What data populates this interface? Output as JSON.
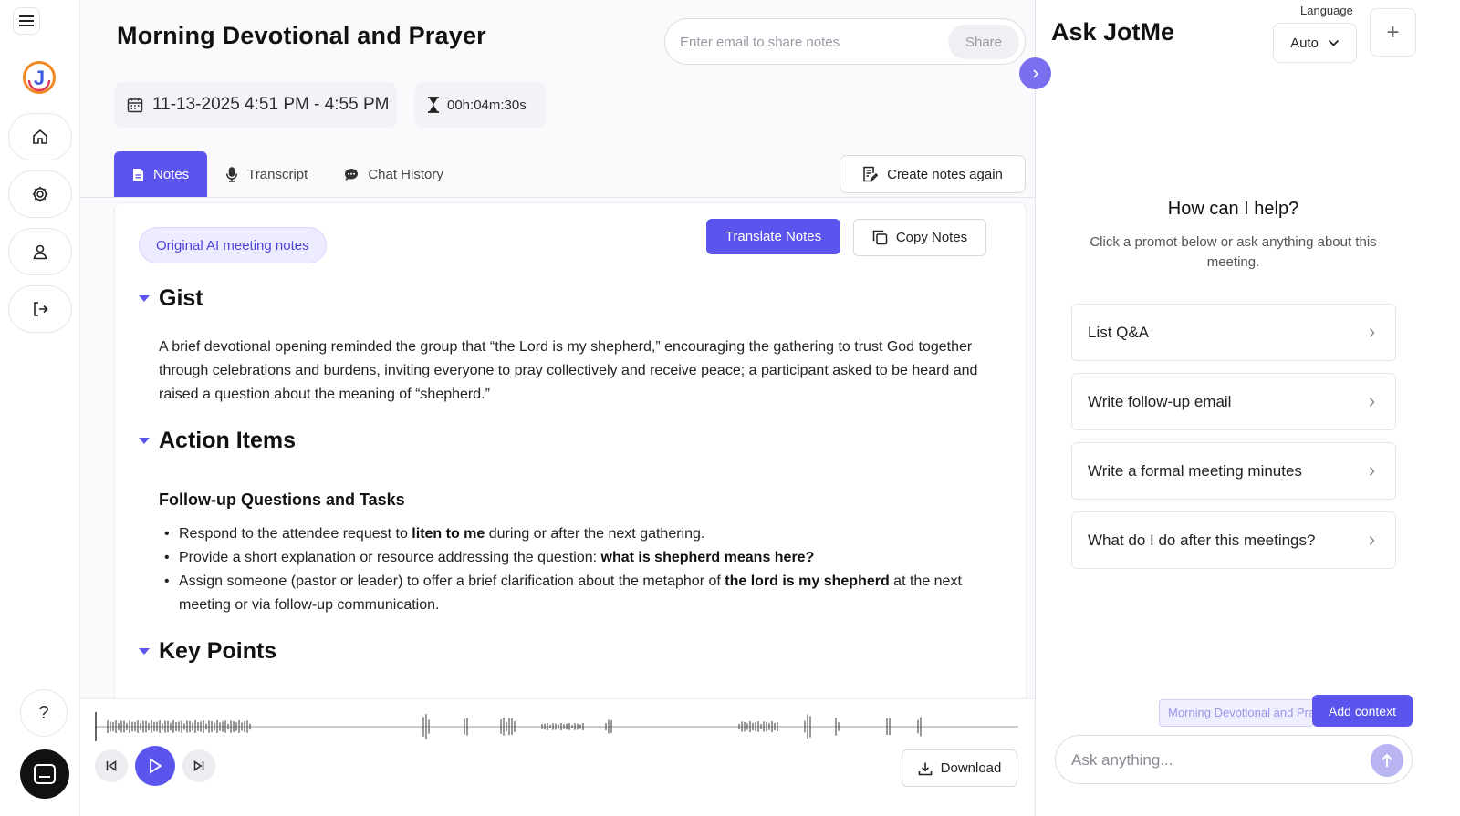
{
  "meeting": {
    "title": "Morning Devotional and Prayer",
    "date_range": "11-13-2025 4:51 PM - 4:55 PM",
    "duration": "00h:04m:30s"
  },
  "share": {
    "placeholder": "Enter email to share notes",
    "button": "Share"
  },
  "tabs": [
    {
      "label": "Notes",
      "icon": "document-icon",
      "active": true
    },
    {
      "label": "Transcript",
      "icon": "microphone-icon",
      "active": false
    },
    {
      "label": "Chat History",
      "icon": "chat-bubble-icon",
      "active": false
    }
  ],
  "toolbar": {
    "create_again": "Create notes again",
    "translate": "Translate Notes",
    "copy": "Copy Notes",
    "original_chip": "Original AI meeting notes"
  },
  "notes": {
    "gist_heading": "Gist",
    "gist_text": "A brief devotional opening reminded the group that “the Lord is my shepherd,” encouraging the gathering to trust God together through celebrations and burdens, inviting everyone to pray collectively and receive peace; a participant asked to be heard and raised a question about the meaning of “shepherd.”",
    "action_heading": "Action Items",
    "action_subheading": "Follow-up Questions and Tasks",
    "actions": [
      {
        "pre": "Respond to the attendee request to ",
        "bold": "liten to me",
        "post": " during or after the next gathering."
      },
      {
        "pre": "Provide a short explanation or resource addressing the question: ",
        "bold": "what is shepherd means here?",
        "post": ""
      },
      {
        "pre": "Assign someone (pastor or leader) to offer a brief clarification about the metaphor of ",
        "bold": "the lord is my shepherd",
        "post": " at the next meeting or via follow-up communication."
      }
    ],
    "keypoints_heading": "Key Points"
  },
  "player": {
    "download": "Download"
  },
  "ask": {
    "title": "Ask JotMe",
    "language_label": "Language",
    "language_value": "Auto",
    "new_button": "+",
    "help_title": "How can I help?",
    "help_sub": "Click a promot below or ask anything about this meeting.",
    "prompts": [
      "List Q&A",
      "Write follow-up email",
      "Write a formal meeting minutes",
      "What do I do after this meetings?"
    ],
    "context_chip": "Morning Devotional and Prayer",
    "add_context": "Add context",
    "input_placeholder": "Ask anything..."
  },
  "rail": {
    "help": "?",
    "logo_letter": "J",
    "nav_icons": [
      "home-icon",
      "gear-icon",
      "user-icon",
      "logout-icon"
    ]
  },
  "colors": {
    "accent": "#5b55ee",
    "accent_light": "#ecebff",
    "logo_ring_orange": "#f08a24",
    "logo_letter_blue": "#3b5bdb"
  }
}
